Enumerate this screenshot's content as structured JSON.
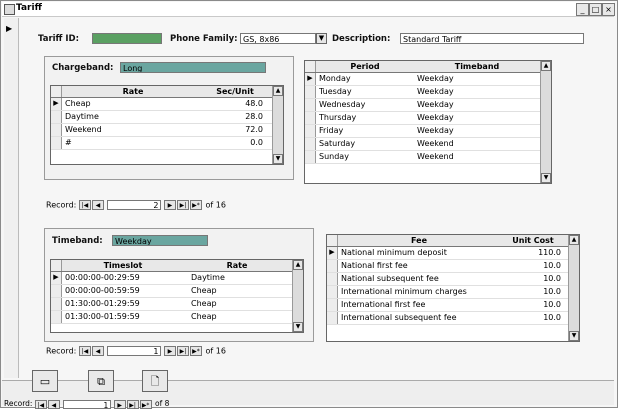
{
  "window": {
    "title": "Tariff",
    "min": "_",
    "max": "□",
    "close": "×"
  },
  "header": {
    "tariff_id_label": "Tariff ID:",
    "phone_family_label": "Phone Family:",
    "phone_family_value": "GS, 8x86",
    "description_label": "Description:",
    "description_value": "Standard Tariff"
  },
  "chargeband": {
    "label": "Chargeband:",
    "value": "Long",
    "columns": [
      "Rate",
      "Sec/Unit"
    ],
    "rows": [
      {
        "rate": "Cheap",
        "sec": "48.0"
      },
      {
        "rate": "Daytime",
        "sec": "28.0"
      },
      {
        "rate": "Weekend",
        "sec": "72.0"
      },
      {
        "rate": "#",
        "sec": "0.0"
      }
    ],
    "nav": {
      "label": "Record:",
      "value": "2",
      "of": "of 16"
    }
  },
  "period": {
    "columns": [
      "Period",
      "Timeband"
    ],
    "rows": [
      {
        "period": "Monday",
        "timeband": "Weekday"
      },
      {
        "period": "Tuesday",
        "timeband": "Weekday"
      },
      {
        "period": "Wednesday",
        "timeband": "Weekday"
      },
      {
        "period": "Thursday",
        "timeband": "Weekday"
      },
      {
        "period": "Friday",
        "timeband": "Weekday"
      },
      {
        "period": "Saturday",
        "timeband": "Weekend"
      },
      {
        "period": "Sunday",
        "timeband": "Weekend"
      }
    ]
  },
  "timeband": {
    "label": "Timeband:",
    "value": "Weekday",
    "columns": [
      "Timeslot",
      "Rate"
    ],
    "rows": [
      {
        "slot": "00:00:00-00:29:59",
        "rate": "Daytime"
      },
      {
        "slot": "00:00:00-00:59:59",
        "rate": "Cheap"
      },
      {
        "slot": "01:30:00-01:29:59",
        "rate": "Cheap"
      },
      {
        "slot": "01:30:00-01:59:59",
        "rate": "Cheap"
      }
    ],
    "nav": {
      "label": "Record:",
      "value": "1",
      "of": "of 16"
    }
  },
  "fees": {
    "columns": [
      "Fee",
      "Unit Cost"
    ],
    "rows": [
      {
        "fee": "National minimum deposit",
        "cost": "110.0"
      },
      {
        "fee": "National first fee",
        "cost": "10.0"
      },
      {
        "fee": "National subsequent fee",
        "cost": "10.0"
      },
      {
        "fee": "International minimum charges",
        "cost": "10.0"
      },
      {
        "fee": "International first fee",
        "cost": "10.0"
      },
      {
        "fee": "International subsequent fee",
        "cost": "10.0"
      }
    ]
  },
  "footer": {
    "label": "Record:",
    "value": "1",
    "of": "of 8"
  }
}
